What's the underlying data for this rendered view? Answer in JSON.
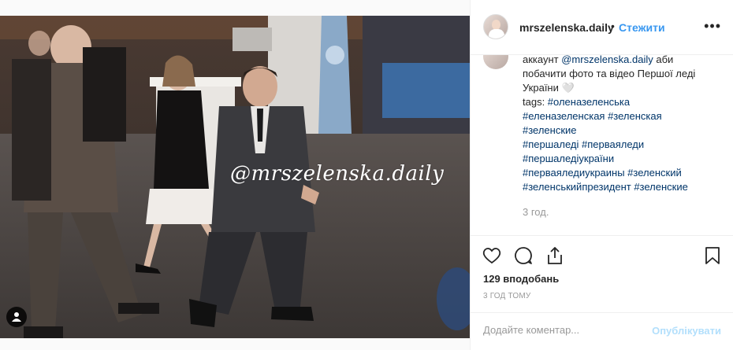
{
  "post": {
    "watermark": "@mrszelenska.daily",
    "user_tag_icon": "user-icon"
  },
  "header": {
    "username": "mrszelenska.daily",
    "separator": "•",
    "follow_label": "Стежити",
    "more_label": "•••"
  },
  "caption": {
    "line1_prefix": "аккаунт ",
    "line1_mention": "@mrszelenska.daily",
    "line1_suffix": " аби",
    "line2": "побачити фото та відео Першої леді",
    "line3": "України 🤍",
    "line4": "tags: ",
    "line4_tag": "#оленазеленська",
    "line5": "#еленазеленская #зеленская",
    "line6": "#зеленские",
    "line7": "#першаледі #перваяледи",
    "line8": "#першаледіукраїни",
    "line9": "#перваяледиукраины #зеленский",
    "line10": "#зеленськийпрезидент #зеленские",
    "time": "3 год."
  },
  "actions": {
    "like_icon": "heart-icon",
    "comment_icon": "comment-icon",
    "share_icon": "share-icon",
    "save_icon": "bookmark-icon"
  },
  "likes_text": "129 вподобань",
  "time_ago": "3 ГОД ТОМУ",
  "comment_box": {
    "placeholder": "Додайте коментар...",
    "publish_label": "Опублікувати"
  },
  "colors": {
    "link": "#3897f0",
    "mention": "#003569",
    "muted": "#999999",
    "publish_disabled": "#b2dffc"
  }
}
